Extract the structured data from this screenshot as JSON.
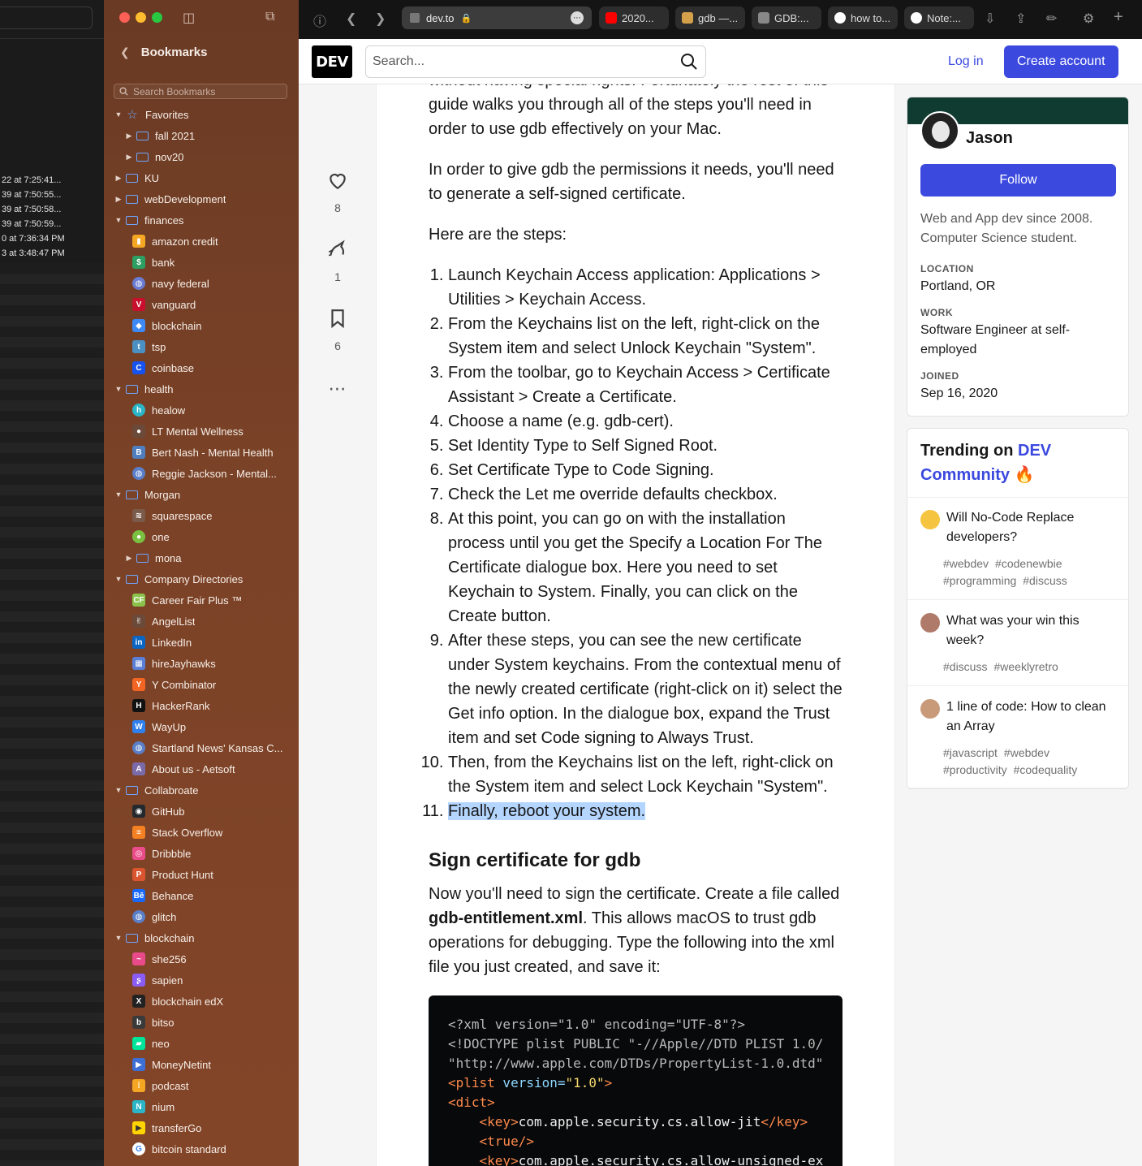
{
  "background_window": {
    "rows": [
      "22 at 7:25:41...",
      "39 at 7:50:55...",
      "39 at 7:50:58...",
      "39 at 7:50:59...",
      "0 at 7:36:34 PM",
      "3 at 3:48:47 PM"
    ]
  },
  "sidebar": {
    "title": "Bookmarks",
    "search_placeholder": "Search Bookmarks",
    "items": [
      {
        "label": "Favorites",
        "type": "group",
        "depth": 0,
        "icon": "star-icon",
        "expanded": true
      },
      {
        "label": "fall 2021",
        "type": "folder",
        "depth": 1,
        "icon": "folder-icon",
        "expanded": false
      },
      {
        "label": "nov20",
        "type": "folder",
        "depth": 1,
        "icon": "folder-icon",
        "expanded": false
      },
      {
        "label": "KU",
        "type": "folder",
        "depth": 0,
        "icon": "folder-icon",
        "expanded": false
      },
      {
        "label": "webDevelopment",
        "type": "folder",
        "depth": 0,
        "icon": "folder-icon",
        "expanded": false
      },
      {
        "label": "finances",
        "type": "folder",
        "depth": 0,
        "icon": "folder-icon",
        "expanded": true
      },
      {
        "label": "amazon credit",
        "type": "link",
        "depth": 1,
        "icon": "bar-chart-icon",
        "color": "#f5a623"
      },
      {
        "label": "bank",
        "type": "link",
        "depth": 1,
        "icon": "bank-icon",
        "color": "#2e9f62"
      },
      {
        "label": "navy federal",
        "type": "link",
        "depth": 1,
        "icon": "globe-icon",
        "color": "#6a7bd1"
      },
      {
        "label": "vanguard",
        "type": "link",
        "depth": 1,
        "icon": "vanguard-icon",
        "color": "#c8102e"
      },
      {
        "label": "blockchain",
        "type": "link",
        "depth": 1,
        "icon": "cube-icon",
        "color": "#3d89f5"
      },
      {
        "label": "tsp",
        "type": "link",
        "depth": 1,
        "icon": "tsp-icon",
        "color": "#4a90c2"
      },
      {
        "label": "coinbase",
        "type": "link",
        "depth": 1,
        "icon": "coinbase-icon",
        "color": "#1652f0"
      },
      {
        "label": "health",
        "type": "folder",
        "depth": 0,
        "icon": "folder-icon",
        "expanded": true
      },
      {
        "label": "healow",
        "type": "link",
        "depth": 1,
        "icon": "healow-icon",
        "color": "#2bb5c7"
      },
      {
        "label": "LT Mental Wellness",
        "type": "link",
        "depth": 1,
        "icon": "drop-icon",
        "color": "#6b4a3a"
      },
      {
        "label": "Bert Nash - Mental Health",
        "type": "link",
        "depth": 1,
        "icon": "bert-nash-icon",
        "color": "#4f7fbf"
      },
      {
        "label": "Reggie Jackson - Mental...",
        "type": "link",
        "depth": 1,
        "icon": "globe-icon",
        "color": "#5a7fc8"
      },
      {
        "label": "Morgan",
        "type": "folder",
        "depth": 0,
        "icon": "folder-icon",
        "expanded": true
      },
      {
        "label": "squarespace",
        "type": "link",
        "depth": 1,
        "icon": "squarespace-icon",
        "color": "#7a5a4a"
      },
      {
        "label": "one",
        "type": "link",
        "depth": 1,
        "icon": "circle-icon",
        "color": "#7ac142"
      },
      {
        "label": "mona",
        "type": "folder",
        "depth": 1,
        "icon": "folder-icon",
        "expanded": false
      },
      {
        "label": "Company Directories",
        "type": "folder",
        "depth": 0,
        "icon": "folder-icon",
        "expanded": true
      },
      {
        "label": "Career Fair Plus ™",
        "type": "link",
        "depth": 1,
        "icon": "career-fair-icon",
        "color": "#8bc34a"
      },
      {
        "label": "AngelList",
        "type": "link",
        "depth": 1,
        "icon": "angellist-icon",
        "color": "#6b4a3a"
      },
      {
        "label": "LinkedIn",
        "type": "link",
        "depth": 1,
        "icon": "linkedin-icon",
        "color": "#0a66c2"
      },
      {
        "label": "hireJayhawks",
        "type": "link",
        "depth": 1,
        "icon": "hirejayhawks-icon",
        "color": "#5b7fd6"
      },
      {
        "label": "Y Combinator",
        "type": "link",
        "depth": 1,
        "icon": "ycombinator-icon",
        "color": "#f26522"
      },
      {
        "label": "HackerRank",
        "type": "link",
        "depth": 1,
        "icon": "hackerrank-icon",
        "color": "#111111"
      },
      {
        "label": "WayUp",
        "type": "link",
        "depth": 1,
        "icon": "wayup-icon",
        "color": "#2f80ed"
      },
      {
        "label": "Startland News' Kansas C...",
        "type": "link",
        "depth": 1,
        "icon": "globe-icon",
        "color": "#5a7fc8"
      },
      {
        "label": "About us - Aetsoft",
        "type": "link",
        "depth": 1,
        "icon": "aetsoft-icon",
        "color": "#7a6aa8"
      },
      {
        "label": "Collabroate",
        "type": "folder",
        "depth": 0,
        "icon": "folder-icon",
        "expanded": true
      },
      {
        "label": "GitHub",
        "type": "link",
        "depth": 1,
        "icon": "github-icon",
        "color": "#24292e"
      },
      {
        "label": "Stack Overflow",
        "type": "link",
        "depth": 1,
        "icon": "stackoverflow-icon",
        "color": "#f48024"
      },
      {
        "label": "Dribbble",
        "type": "link",
        "depth": 1,
        "icon": "dribbble-icon",
        "color": "#ea4c89"
      },
      {
        "label": "Product Hunt",
        "type": "link",
        "depth": 1,
        "icon": "producthunt-icon",
        "color": "#da552f"
      },
      {
        "label": "Behance",
        "type": "link",
        "depth": 1,
        "icon": "behance-icon",
        "color": "#1769ff"
      },
      {
        "label": "glitch",
        "type": "link",
        "depth": 1,
        "icon": "globe-icon",
        "color": "#5a7fc8"
      },
      {
        "label": "blockchain",
        "type": "folder",
        "depth": 0,
        "icon": "folder-icon",
        "expanded": true
      },
      {
        "label": "she256",
        "type": "link",
        "depth": 1,
        "icon": "she256-icon",
        "color": "#e84a8a"
      },
      {
        "label": "sapien",
        "type": "link",
        "depth": 1,
        "icon": "sapien-icon",
        "color": "#8a5cf5"
      },
      {
        "label": "blockchain edX",
        "type": "link",
        "depth": 1,
        "icon": "edx-icon",
        "color": "#222222"
      },
      {
        "label": "bitso",
        "type": "link",
        "depth": 1,
        "icon": "bitso-icon",
        "color": "#3a3a3a"
      },
      {
        "label": "neo",
        "type": "link",
        "depth": 1,
        "icon": "neo-icon",
        "color": "#00e599"
      },
      {
        "label": "MoneyNetint",
        "type": "link",
        "depth": 1,
        "icon": "moneynetint-icon",
        "color": "#3d6fd6"
      },
      {
        "label": "podcast",
        "type": "link",
        "depth": 1,
        "icon": "podcast-icon",
        "color": "#f5a623"
      },
      {
        "label": "nium",
        "type": "link",
        "depth": 1,
        "icon": "nium-icon",
        "color": "#2bb5c7"
      },
      {
        "label": "transferGo",
        "type": "link",
        "depth": 1,
        "icon": "transfergo-icon",
        "color": "#ffd400"
      },
      {
        "label": "bitcoin standard",
        "type": "link",
        "depth": 1,
        "icon": "google-icon",
        "color": "#ffffff"
      }
    ]
  },
  "browser": {
    "address": "dev.to",
    "tabs": [
      {
        "label": "2020...",
        "icon": "youtube-icon",
        "color": "#ff0000"
      },
      {
        "label": "gdb —...",
        "icon": "gdb-icon",
        "color": "#d4a04a"
      },
      {
        "label": "GDB:...",
        "icon": "gdb-doc-icon",
        "color": "#888888"
      },
      {
        "label": "how to...",
        "icon": "google-icon",
        "color": "#ffffff"
      },
      {
        "label": "Note:...",
        "icon": "google-icon",
        "color": "#ffffff"
      }
    ]
  },
  "dev": {
    "logo": "DEV",
    "search_placeholder": "Search...",
    "login": "Log in",
    "create_account": "Create account",
    "accent": "#3b49df"
  },
  "reactions": {
    "hearts": "8",
    "unicorns": "1",
    "bookmarks": "6"
  },
  "article": {
    "para_top": "without having special rights. Fortunately the rest of this guide walks you through all of the steps you'll need in order to use gdb effectively on your Mac.",
    "para_cert": "In order to give gdb the permissions it needs, you'll need to generate a self-signed certificate.",
    "para_steps": "Here are the steps:",
    "steps": [
      "Launch Keychain Access application: Applications > Utilities > Keychain Access.",
      "From the Keychains list on the left, right-click on the System item and select Unlock Keychain \"System\".",
      "From the toolbar, go to Keychain Access > Certificate Assistant > Create a Certificate.",
      "Choose a name (e.g. gdb-cert).",
      "Set Identity Type to Self Signed Root.",
      "Set Certificate Type to Code Signing.",
      "Check the Let me override defaults checkbox.",
      "At this point, you can go on with the installation process until you get the Specify a Location For The Certificate dialogue box. Here you need to set Keychain to System. Finally, you can click on the Create button.",
      "After these steps, you can see the new certificate under System keychains. From the contextual menu of the newly created certificate (right-click on it) select the Get info option. In the dialogue box, expand the Trust item and set Code signing to Always Trust.",
      "Then, from the Keychains list on the left, right-click on the System item and select Lock Keychain \"System\".",
      "Finally, reboot your system."
    ],
    "heading_sign": "Sign certificate for gdb",
    "para_sign_1": "Now you'll need to sign the certificate. Create a file called ",
    "para_sign_bold": "gdb-entitlement.xml",
    "para_sign_2": ". This allows macOS to trust gdb operations for debugging. Type the following into the xml file you just created, and save it:",
    "code": {
      "line1": "<?xml version=\"1.0\" encoding=\"UTF-8\"?>",
      "line2": "<!DOCTYPE plist PUBLIC \"-//Apple//DTD PLIST 1.0/",
      "line3": "\"http://www.apple.com/DTDs/PropertyList-1.0.dtd\"",
      "plist_open": "<plist",
      "plist_attr": " version=",
      "plist_val": "\"1.0\"",
      "plist_close": ">",
      "dict": "<dict>",
      "key_open": "<key>",
      "key_close": "</key>",
      "key1": "com.apple.security.cs.allow-jit",
      "true": "<true/>",
      "key2": "com.apple.security.cs.allow-unsigned-ex"
    }
  },
  "profile": {
    "name": "Jason",
    "follow": "Follow",
    "bio": "Web and App dev since 2008. Computer Science student.",
    "location_label": "LOCATION",
    "location": "Portland, OR",
    "work_label": "WORK",
    "work": "Software Engineer at self-employed",
    "joined_label": "JOINED",
    "joined": "Sep 16, 2020"
  },
  "trending": {
    "title_prefix": "Trending on ",
    "title_accent": "DEV Community",
    "emoji": "🔥",
    "items": [
      {
        "title": "Will No-Code Replace developers?",
        "tags": [
          "#webdev",
          "#codenewbie",
          "#programming",
          "#discuss"
        ],
        "avatar_color": "#f5c542"
      },
      {
        "title": "What was your win this week?",
        "tags": [
          "#discuss",
          "#weeklyretro"
        ],
        "avatar_color": "#b07a6a"
      },
      {
        "title": "1 line of code: How to clean an Array",
        "tags": [
          "#javascript",
          "#webdev",
          "#productivity",
          "#codequality"
        ],
        "avatar_color": "#c99a7a"
      }
    ]
  }
}
